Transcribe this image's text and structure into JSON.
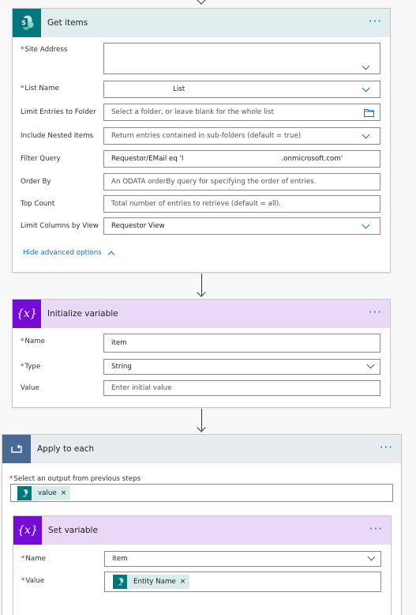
{
  "get_items": {
    "title": "Get items",
    "more": "···",
    "fields": {
      "site_address": {
        "label": "Site Address",
        "value": ""
      },
      "list_name": {
        "label": "List Name",
        "value": "List"
      },
      "limit_folder": {
        "label": "Limit Entries to Folder",
        "placeholder": "Select a folder, or leave blank for the whole list"
      },
      "nested": {
        "label": "Include Nested Items",
        "value": "Return entries contained in sub-folders (default = true)"
      },
      "filter": {
        "label": "Filter Query",
        "value_prefix": "Requestor/EMail eq 'l",
        "value_suffix": ".onmicrosoft.com'"
      },
      "order_by": {
        "label": "Order By",
        "placeholder": "An ODATA orderBy query for specifying the order of entries."
      },
      "top_count": {
        "label": "Top Count",
        "placeholder": "Total number of entries to retrieve (default = all)."
      },
      "limit_view": {
        "label": "Limit Columns by View",
        "value": "Requestor View"
      }
    },
    "hide_advanced": "Hide advanced options"
  },
  "init_var": {
    "title": "Initialize variable",
    "more": "···",
    "badge": "{x}",
    "fields": {
      "name": {
        "label": "Name",
        "value": "item"
      },
      "type": {
        "label": "Type",
        "value": "String"
      },
      "value": {
        "label": "Value",
        "placeholder": "Enter initial value"
      }
    }
  },
  "apply_each": {
    "title": "Apply to each",
    "more": "···",
    "select_label": "Select an output from previous steps",
    "token": "value",
    "token_x": "×"
  },
  "set_var": {
    "title": "Set variable",
    "more": "···",
    "badge": "{x}",
    "fields": {
      "name": {
        "label": "Name",
        "value": "item"
      },
      "value": {
        "label": "Value",
        "token": "Entity Name",
        "token_x": "×"
      }
    }
  },
  "required_mark": "*"
}
